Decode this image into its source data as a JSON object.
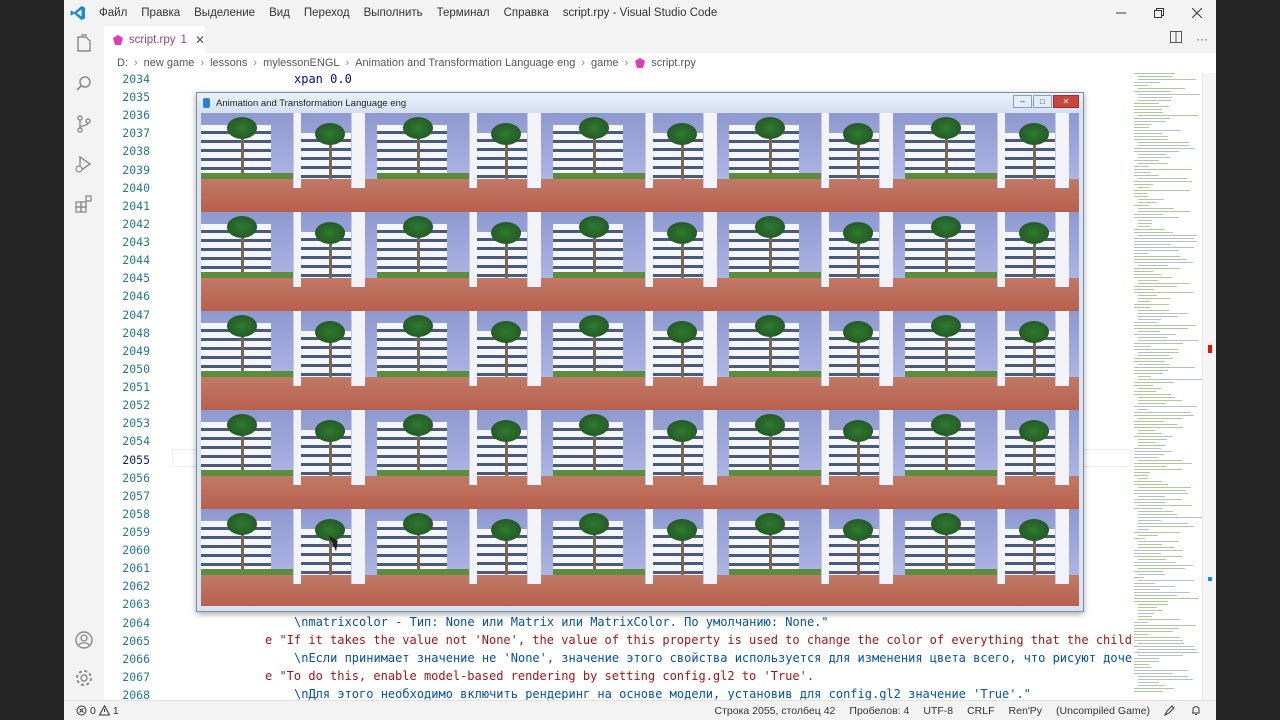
{
  "app": {
    "window_title": "script.rpy - Visual Studio Code",
    "menu": [
      "Файл",
      "Правка",
      "Выделение",
      "Вид",
      "Переход",
      "Выполнить",
      "Терминал",
      "Справка"
    ]
  },
  "tab": {
    "label": "script.rpy",
    "problems": "1"
  },
  "breadcrumb": [
    "D:",
    "new game",
    "lessons",
    "mylessonENGL",
    "Animation and Transformation Language eng",
    "game",
    "script.rpy"
  ],
  "editor": {
    "line_numbers": [
      "2034",
      "2035",
      "2036",
      "2037",
      "2038",
      "2039",
      "2040",
      "2041",
      "2042",
      "2043",
      "2044",
      "2045",
      "2046",
      "2047",
      "2048",
      "2049",
      "2050",
      "2051",
      "2052",
      "2053",
      "2054",
      "2055",
      "2056",
      "2057",
      "2058",
      "2059",
      "2060",
      "2061",
      "2062",
      "2063",
      "2064",
      "2065",
      "2066",
      "2067",
      "2068"
    ],
    "active_line": "2055",
    "lines": {
      "l2034": "xpan 0.0",
      "l2064": "\\nmatrixcolor - Тип: None или Matrix или MatrixColor. По умолчанию: None.\"",
      "l2065": "e \"If it takes the value not 'None', the value of this property is used to change the color of everything that the child element",
      "l2066": "\\nЕсли принимает значение не 'None', значение этого свойства используется для изменения цвета всего, что рисуют дочерние эле",
      "l2067": "e \"To do this, enable model-based rendering by setting config.gl2 to 'True'.",
      "l2068": "\\nДля этого необходимо включить рендеринг на основе модели, установив для config.gl2 значение 'True'.\""
    }
  },
  "game_window": {
    "title": "Animation and Transformation Language eng"
  },
  "status": {
    "errors": "0",
    "warnings": "1",
    "position": "Строка 2055, столбец 42",
    "spaces": "Пробелов: 4",
    "encoding": "UTF-8",
    "eol": "CRLF",
    "language": "Ren'Py",
    "game_state": "(Uncompiled Game)"
  },
  "colors": {
    "accent": "#007acc",
    "line_number": "#237893",
    "string": "#a31515"
  }
}
